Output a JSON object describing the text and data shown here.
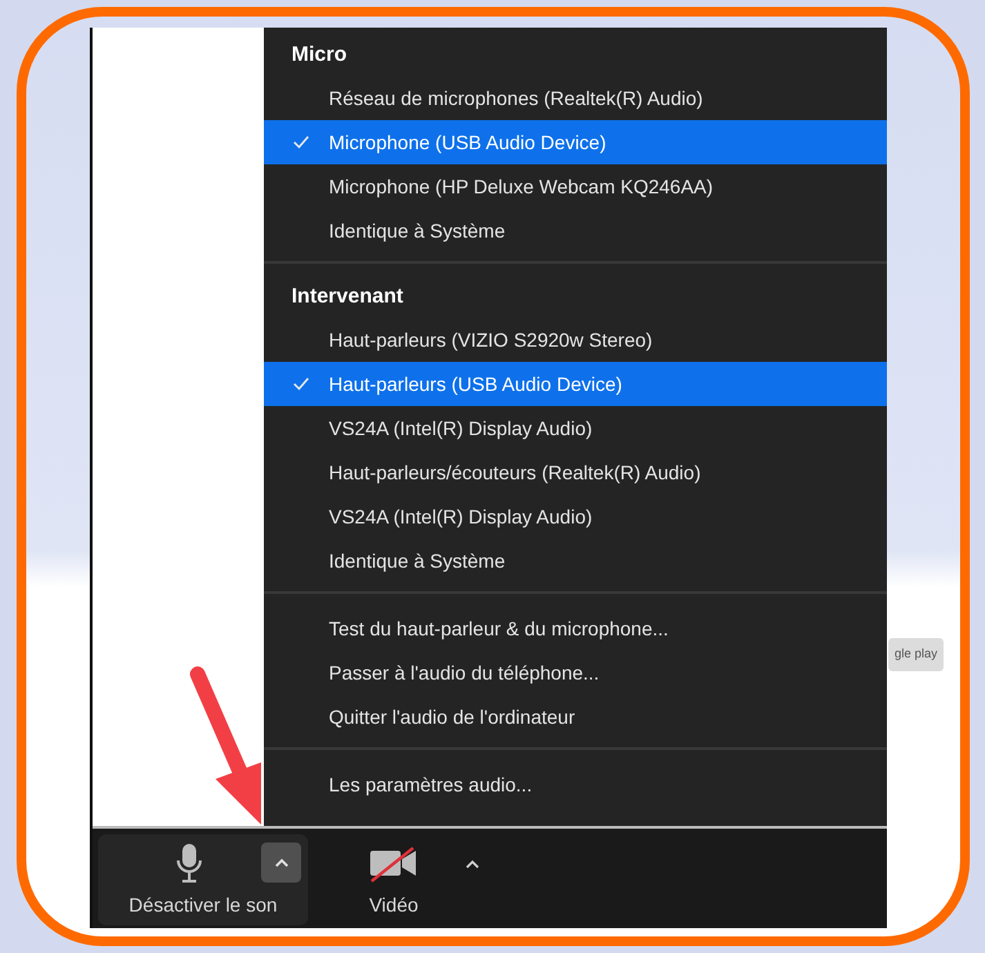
{
  "menu": {
    "sections": [
      {
        "title": "Micro",
        "items": [
          {
            "label": "Réseau de microphones (Realtek(R) Audio)",
            "selected": false
          },
          {
            "label": "Microphone (USB Audio Device)",
            "selected": true
          },
          {
            "label": "Microphone (HP Deluxe Webcam KQ246AA)",
            "selected": false
          },
          {
            "label": "Identique à Système",
            "selected": false
          }
        ]
      },
      {
        "title": "Intervenant",
        "items": [
          {
            "label": "Haut-parleurs (VIZIO S2920w Stereo)",
            "selected": false
          },
          {
            "label": "Haut-parleurs (USB Audio Device)",
            "selected": true
          },
          {
            "label": "VS24A (Intel(R) Display Audio)",
            "selected": false
          },
          {
            "label": "Haut-parleurs/écouteurs (Realtek(R) Audio)",
            "selected": false
          },
          {
            "label": "VS24A (Intel(R) Display Audio)",
            "selected": false
          },
          {
            "label": "Identique à Système",
            "selected": false
          }
        ]
      },
      {
        "items": [
          {
            "label": "Test du haut-parleur & du microphone...",
            "selected": false
          },
          {
            "label": "Passer à l'audio du téléphone...",
            "selected": false
          },
          {
            "label": "Quitter l'audio de l'ordinateur",
            "selected": false
          }
        ]
      },
      {
        "items": [
          {
            "label": "Les paramètres audio...",
            "selected": false
          }
        ]
      }
    ]
  },
  "store_badge": "gle play",
  "toolbar": {
    "mute_label": "Désactiver le son",
    "video_label": "Vidéo"
  }
}
